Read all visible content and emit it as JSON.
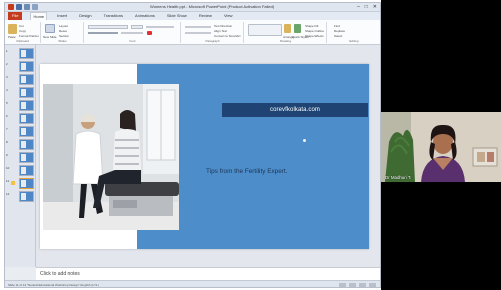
{
  "window": {
    "title": "Womens Health.ppt - Microsoft PowerPoint (Product Activation Failed)",
    "controls": {
      "minimize": "–",
      "maximize": "□",
      "close": "✕"
    }
  },
  "ribbon": {
    "tabs": [
      "File",
      "Home",
      "Insert",
      "Design",
      "Transitions",
      "Animations",
      "Slide Show",
      "Review",
      "View"
    ],
    "active_tab": "Home",
    "groups": [
      "Clipboard",
      "Slides",
      "Font",
      "Paragraph",
      "Drawing",
      "Editing"
    ],
    "buttons": {
      "paste": "Paste",
      "cut": "Cut",
      "copy": "Copy",
      "format_painter": "Format Painter",
      "new_slide": "New Slide",
      "layout": "Layout",
      "reset": "Reset",
      "section": "Section",
      "text_direction": "Text Direction",
      "align_text": "Align Text",
      "convert_smartart": "Convert to SmartArt",
      "arrange": "Arrange",
      "quick_styles": "Quick Styles",
      "shape_fill": "Shape Fill",
      "shape_outline": "Shape Outline",
      "shape_effects": "Shape Effects",
      "find": "Find",
      "replace": "Replace",
      "select": "Select"
    }
  },
  "thumbnails": {
    "numbers": [
      "1",
      "2",
      "3",
      "4",
      "5",
      "6",
      "7",
      "8",
      "9",
      "10",
      "11",
      "12"
    ],
    "selected_index": 10
  },
  "slide": {
    "url": "corevfkolkata.com",
    "tagline": "Tips from the Fertility Expert.",
    "colors": {
      "panel": "#4d8dc9",
      "url_bar": "#1f4473",
      "tagline": "#1d3558"
    }
  },
  "notes": {
    "placeholder": "Click to add notes"
  },
  "statusbar": {
    "text": "Slide 11 of 12    \"Neutral Educational Workshop Design\"    English (U.S.)"
  },
  "webcam": {
    "name_label": "Dr Madhuri T."
  }
}
